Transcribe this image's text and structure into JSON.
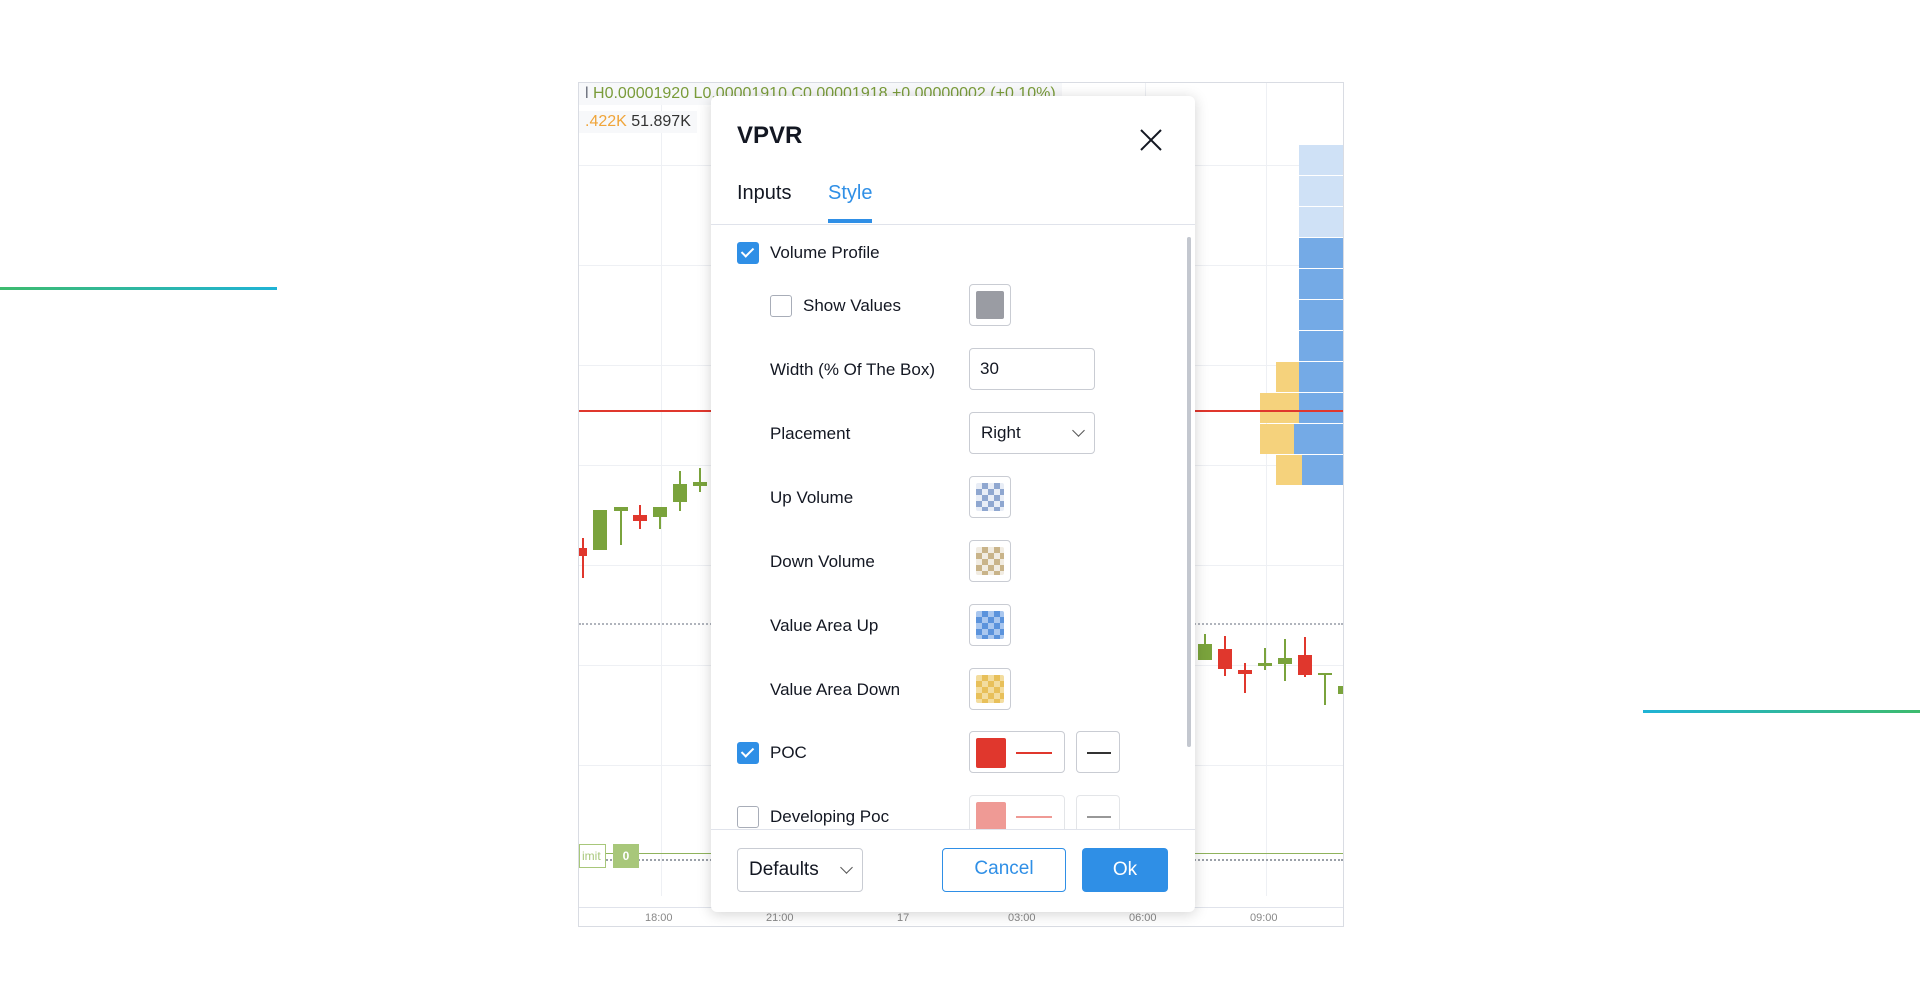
{
  "chart": {
    "legend_ohlc": "H0.00001920 L0.00001910 C0.00001918 +0.00000002 (+0.10%)",
    "legend_prefix": "l",
    "legend_volume_a": ".422K",
    "legend_volume_b": "51.897K",
    "limit_label": "imit",
    "limit_badge": "0",
    "time_ticks": [
      "18:00",
      "21:00",
      "17",
      "03:00",
      "06:00",
      "09:00"
    ]
  },
  "dialog": {
    "title": "VPVR",
    "tabs": [
      {
        "label": "Inputs",
        "active": false
      },
      {
        "label": "Style",
        "active": true
      }
    ],
    "rows": {
      "volume_profile": {
        "label": "Volume Profile",
        "checked": true
      },
      "show_values": {
        "label": "Show Values",
        "checked": false
      },
      "width": {
        "label": "Width (% Of The Box)",
        "value": "30"
      },
      "placement": {
        "label": "Placement",
        "value": "Right"
      },
      "up_volume": {
        "label": "Up Volume"
      },
      "down_volume": {
        "label": "Down Volume"
      },
      "value_area_up": {
        "label": "Value Area Up"
      },
      "value_area_down": {
        "label": "Value Area Down"
      },
      "poc": {
        "label": "POC",
        "checked": true
      },
      "developing_poc": {
        "label": "Developing Poc",
        "checked": false
      }
    },
    "footer": {
      "defaults_label": "Defaults",
      "cancel_label": "Cancel",
      "ok_label": "Ok"
    }
  },
  "colors": {
    "accent": "#2f8fe6",
    "poc_red": "#e0372d",
    "show_values_gray": "#9a9ca3",
    "up_volume": "#8fa7d0",
    "down_volume": "#c9b48a",
    "value_area_up": "#5b93dc",
    "value_area_down": "#e8c05a",
    "developing_poc": "#ee9590"
  }
}
